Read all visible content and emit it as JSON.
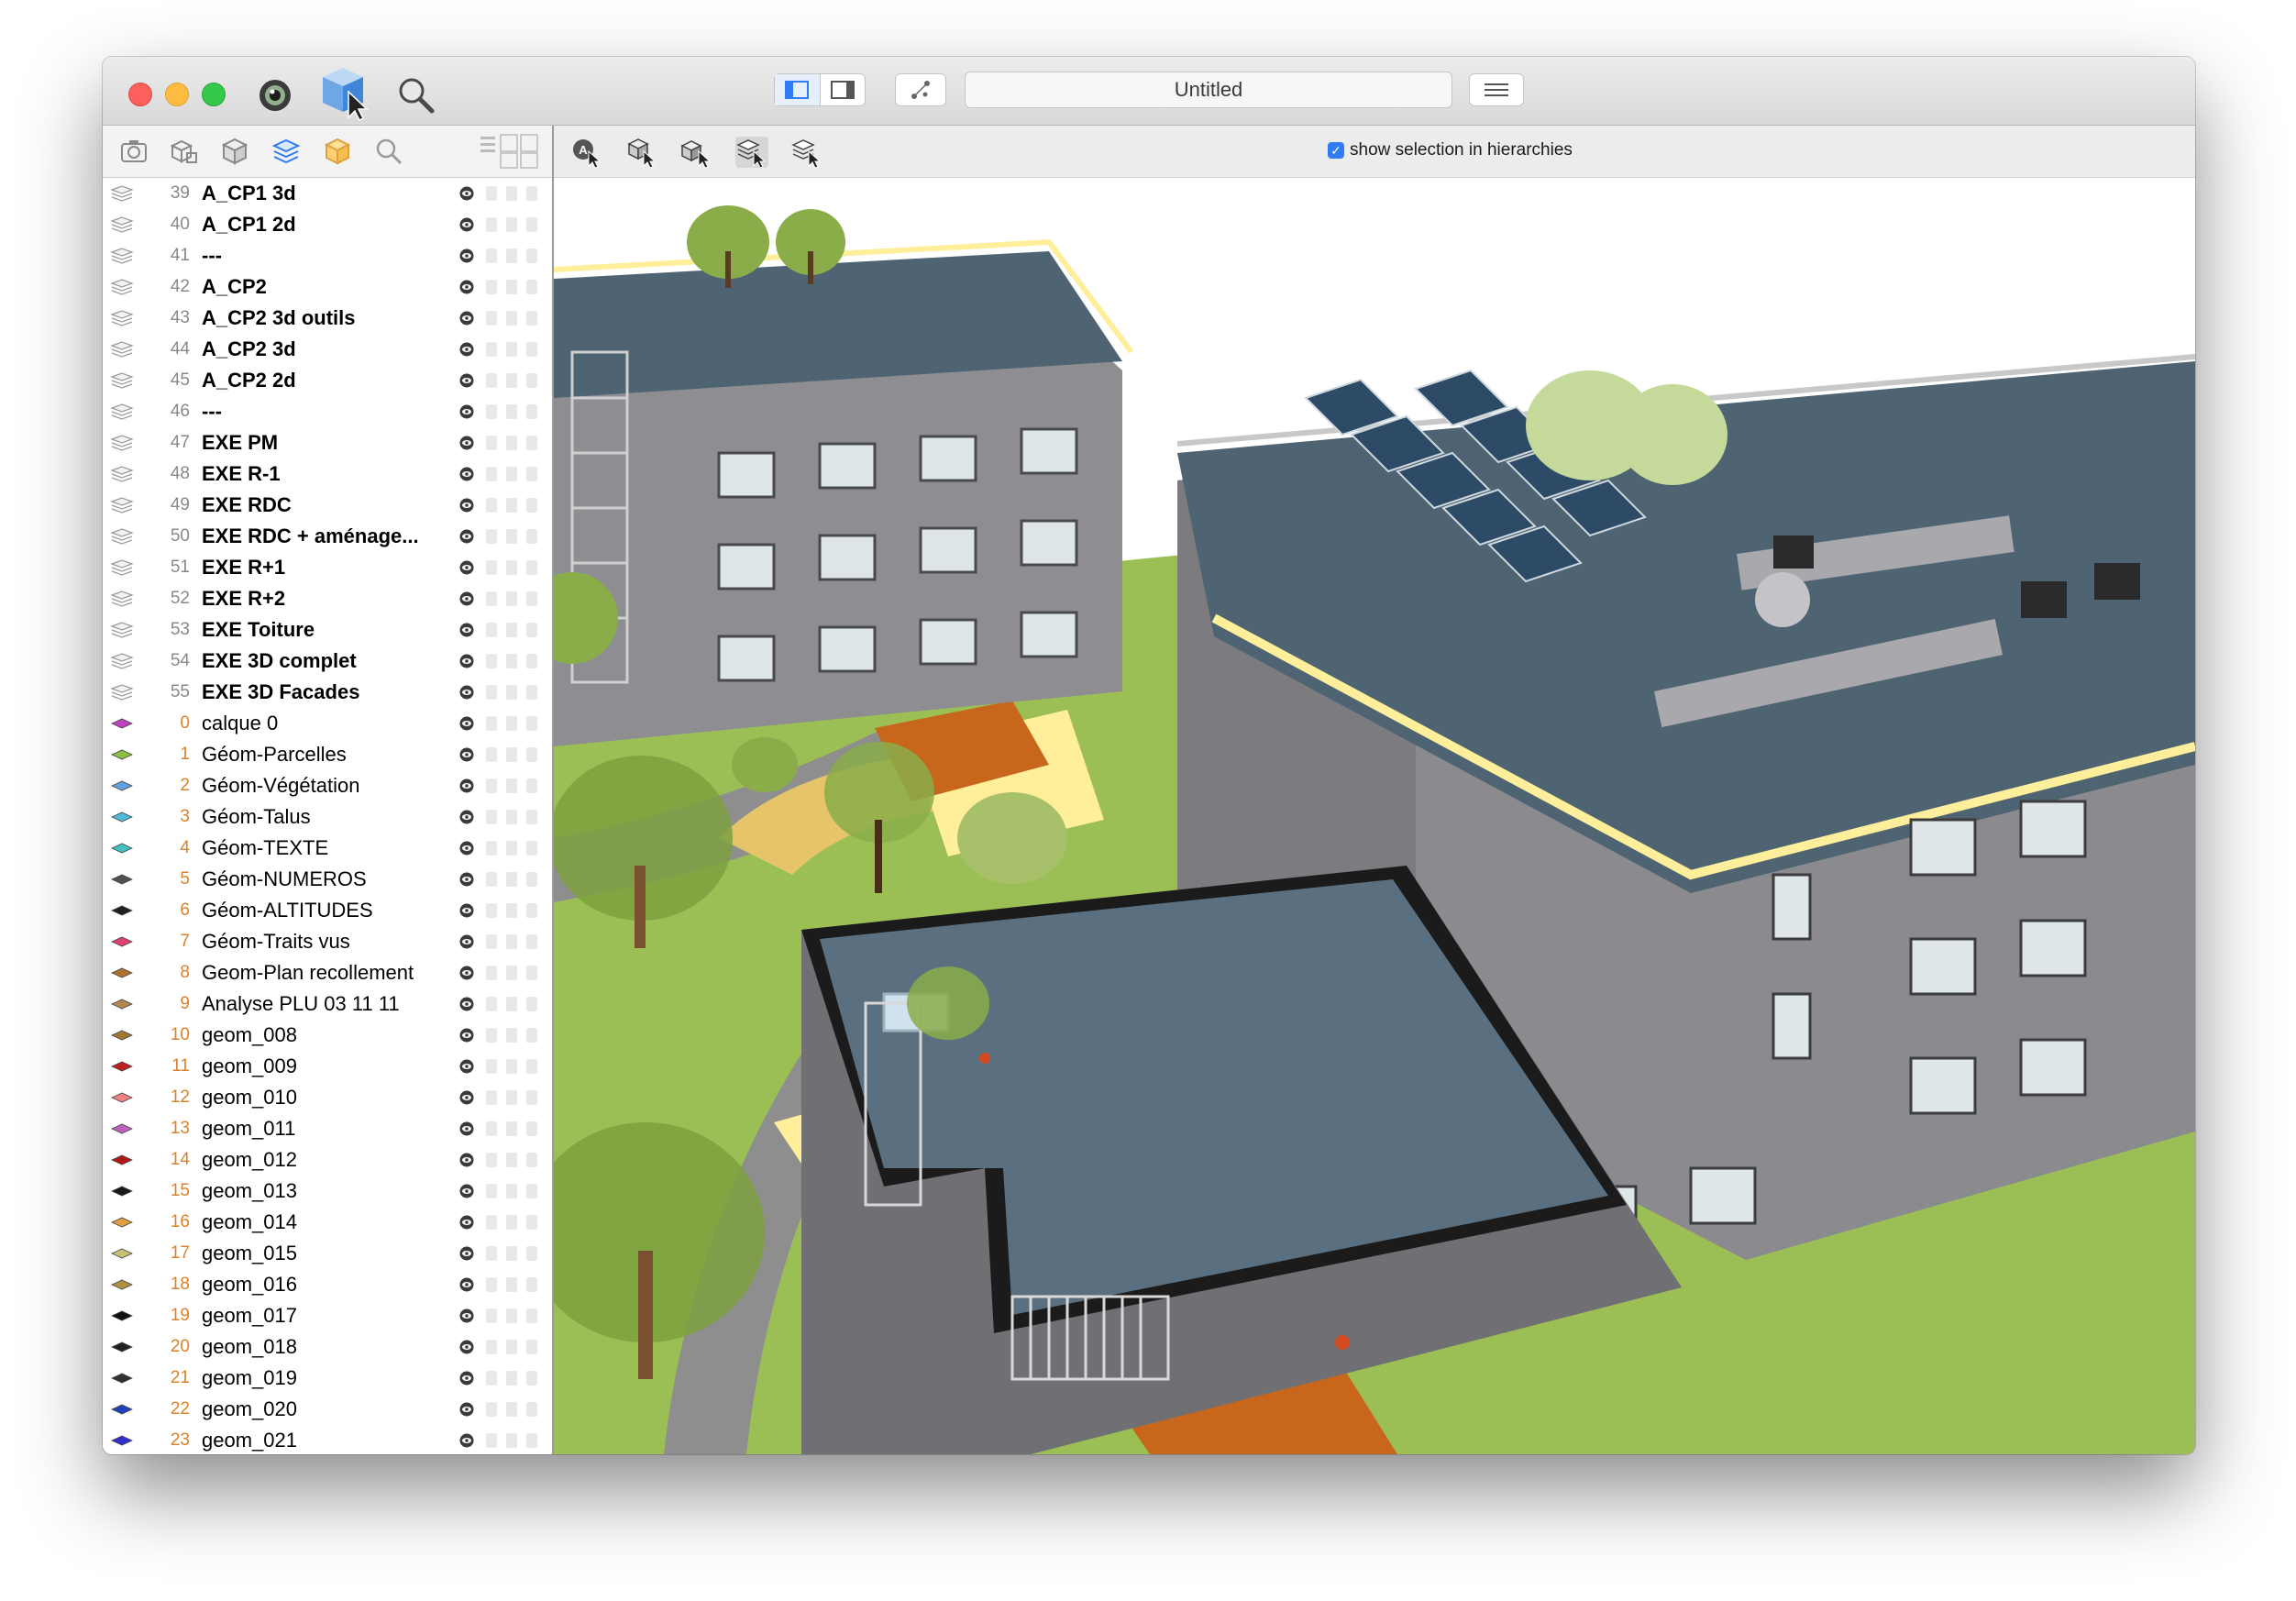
{
  "window": {
    "title": "Untitled"
  },
  "toolbar": {
    "icons": [
      "render-eye-icon",
      "select-cube-icon",
      "zoom-icon",
      "sidebar-left-icon",
      "sidebar-right-icon",
      "network-icon",
      "menu-icon"
    ]
  },
  "sidebar_toolbar": {
    "icons": [
      "camera-icon",
      "objects-icon",
      "cube-icon",
      "layers-icon",
      "materials-icon",
      "search-icon",
      "grid-view-icon"
    ]
  },
  "viewport_toolbar": {
    "icons": [
      "select-all-icon",
      "select-object-icon",
      "select-group-icon",
      "select-layer-icon",
      "select-material-icon"
    ],
    "show_selection": {
      "checked": true,
      "label": "show selection in hierarchies"
    }
  },
  "layers": [
    {
      "num": "39",
      "name": "A_CP1 3d",
      "bold": true,
      "color": "#999999"
    },
    {
      "num": "40",
      "name": "A_CP1 2d",
      "bold": true,
      "color": "#999999"
    },
    {
      "num": "41",
      "name": "---",
      "bold": true,
      "color": "#999999"
    },
    {
      "num": "42",
      "name": "A_CP2",
      "bold": true,
      "color": "#999999"
    },
    {
      "num": "43",
      "name": "A_CP2 3d outils",
      "bold": true,
      "color": "#999999"
    },
    {
      "num": "44",
      "name": "A_CP2 3d",
      "bold": true,
      "color": "#999999"
    },
    {
      "num": "45",
      "name": "A_CP2 2d",
      "bold": true,
      "color": "#999999"
    },
    {
      "num": "46",
      "name": "---",
      "bold": true,
      "color": "#999999"
    },
    {
      "num": "47",
      "name": "EXE PM",
      "bold": true,
      "color": "#999999"
    },
    {
      "num": "48",
      "name": "EXE R-1",
      "bold": true,
      "color": "#999999"
    },
    {
      "num": "49",
      "name": "EXE RDC",
      "bold": true,
      "color": "#999999"
    },
    {
      "num": "50",
      "name": "EXE RDC + aménage...",
      "bold": true,
      "color": "#999999"
    },
    {
      "num": "51",
      "name": "EXE R+1",
      "bold": true,
      "color": "#999999"
    },
    {
      "num": "52",
      "name": "EXE R+2",
      "bold": true,
      "color": "#999999"
    },
    {
      "num": "53",
      "name": "EXE Toiture",
      "bold": true,
      "color": "#999999"
    },
    {
      "num": "54",
      "name": "EXE 3D complet",
      "bold": true,
      "color": "#999999"
    },
    {
      "num": "55",
      "name": "EXE 3D Facades",
      "bold": true,
      "color": "#999999"
    },
    {
      "num": "0",
      "name": "calque 0",
      "bold": false,
      "color": "#c040c0"
    },
    {
      "num": "1",
      "name": "Géom-Parcelles",
      "bold": false,
      "color": "#8cc040"
    },
    {
      "num": "2",
      "name": "Géom-Végétation",
      "bold": false,
      "color": "#60a0e0"
    },
    {
      "num": "3",
      "name": "Géom-Talus",
      "bold": false,
      "color": "#50b8d8"
    },
    {
      "num": "4",
      "name": "Géom-TEXTE",
      "bold": false,
      "color": "#40c0c0"
    },
    {
      "num": "5",
      "name": "Géom-NUMEROS",
      "bold": false,
      "color": "#505050"
    },
    {
      "num": "6",
      "name": "Géom-ALTITUDES",
      "bold": false,
      "color": "#202020"
    },
    {
      "num": "7",
      "name": "Géom-Traits vus",
      "bold": false,
      "color": "#e04070"
    },
    {
      "num": "8",
      "name": "Geom-Plan recollement",
      "bold": false,
      "color": "#b07030"
    },
    {
      "num": "9",
      "name": "Analyse PLU 03 11 11",
      "bold": false,
      "color": "#b08850"
    },
    {
      "num": "10",
      "name": "geom_008",
      "bold": false,
      "color": "#a07830"
    },
    {
      "num": "11",
      "name": "geom_009",
      "bold": false,
      "color": "#c02020"
    },
    {
      "num": "12",
      "name": "geom_010",
      "bold": false,
      "color": "#f08080"
    },
    {
      "num": "13",
      "name": "geom_011",
      "bold": false,
      "color": "#c060c0"
    },
    {
      "num": "14",
      "name": "geom_012",
      "bold": false,
      "color": "#b01818"
    },
    {
      "num": "15",
      "name": "geom_013",
      "bold": false,
      "color": "#181818"
    },
    {
      "num": "16",
      "name": "geom_014",
      "bold": false,
      "color": "#e0a040"
    },
    {
      "num": "17",
      "name": "geom_015",
      "bold": false,
      "color": "#c8c070"
    },
    {
      "num": "18",
      "name": "geom_016",
      "bold": false,
      "color": "#b09040"
    },
    {
      "num": "19",
      "name": "geom_017",
      "bold": false,
      "color": "#101010"
    },
    {
      "num": "20",
      "name": "geom_018",
      "bold": false,
      "color": "#202020"
    },
    {
      "num": "21",
      "name": "geom_019",
      "bold": false,
      "color": "#303030"
    },
    {
      "num": "22",
      "name": "geom_020",
      "bold": false,
      "color": "#2040c0"
    },
    {
      "num": "23",
      "name": "geom_021",
      "bold": false,
      "color": "#3030d0"
    }
  ],
  "colors": {
    "accent": "#2f7cf6",
    "grass": "#9bbf55",
    "roof": "#5a7080",
    "facade": "#8d8d92"
  }
}
